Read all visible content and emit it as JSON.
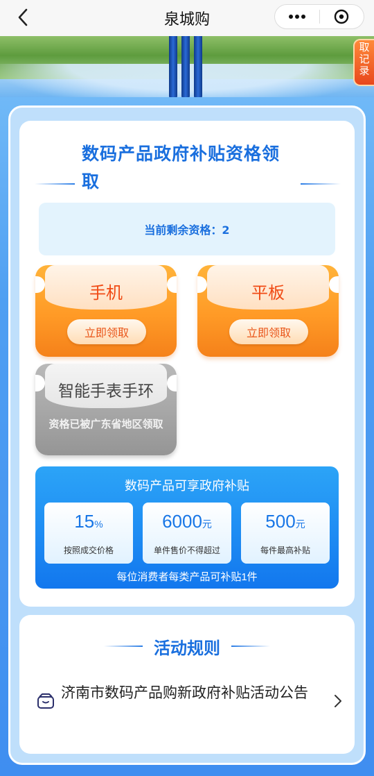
{
  "nav": {
    "title": "泉城购"
  },
  "hero": {
    "record_tab": "取记录"
  },
  "eligibility": {
    "title": "数码产品政府补贴资格领取",
    "remaining": "当前剩余资格：2"
  },
  "coupons": [
    {
      "name": "手机",
      "action": "立即领取",
      "state": "available"
    },
    {
      "name": "平板",
      "action": "立即领取",
      "state": "available"
    },
    {
      "name": "智能手表手环",
      "status": "资格已被广东省地区领取",
      "state": "claimed"
    }
  ],
  "subsidy": {
    "title": "数码产品可享政府补贴",
    "stats": [
      {
        "value": "15",
        "unit": "%",
        "desc": "按照成交价格"
      },
      {
        "value": "6000",
        "unit": "元",
        "desc": "单件售价不得超过"
      },
      {
        "value": "500",
        "unit": "元",
        "desc": "每件最高补贴"
      }
    ],
    "note": "每位消费者每类产品可补贴1件"
  },
  "rules": {
    "title": "活动规则",
    "notice": "济南市数码产品购新政府补贴活动公告"
  },
  "colors": {
    "accent_blue": "#1a6fde",
    "coupon_orange": "#ff9a26",
    "coupon_text": "#f04a14",
    "page_bg": "#3f8ef0"
  },
  "icons": [
    "back-arrow-icon",
    "more-dots-icon",
    "close-circle-icon",
    "notice-box-icon",
    "chevron-right-icon"
  ]
}
